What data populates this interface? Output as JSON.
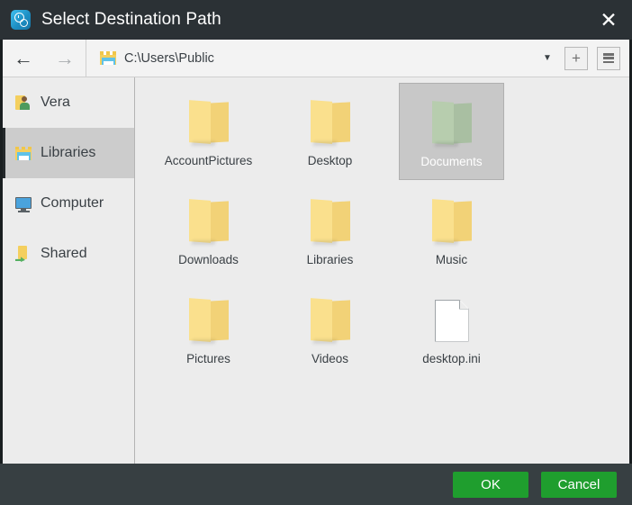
{
  "window": {
    "title": "Select Destination Path",
    "app_icon": "clock-gear-icon",
    "close_label": "✕",
    "titlebar_color": "#2b3135",
    "footer_color": "#373f42",
    "accent_color": "#1f9e2e"
  },
  "toolbar": {
    "back_label": "←",
    "forward_label": "→",
    "path_icon": "libraries-folder-icon",
    "path_value": "C:\\Users\\Public",
    "dropdown_label": "▼",
    "new_folder_label": "+",
    "view_toggle_icon": "list-view-icon"
  },
  "sidebar": {
    "items": [
      {
        "label": "Vera",
        "icon": "user-folder-icon",
        "selected": false
      },
      {
        "label": "Libraries",
        "icon": "libraries-icon",
        "selected": true
      },
      {
        "label": "Computer",
        "icon": "computer-icon",
        "selected": false
      },
      {
        "label": "Shared",
        "icon": "shared-folder-icon",
        "selected": false
      }
    ]
  },
  "files": {
    "items": [
      {
        "name": "AccountPictures",
        "type": "folder",
        "selected": false
      },
      {
        "name": "Desktop",
        "type": "folder",
        "selected": false
      },
      {
        "name": "Documents",
        "type": "folder",
        "selected": true
      },
      {
        "name": "Downloads",
        "type": "folder",
        "selected": false
      },
      {
        "name": "Libraries",
        "type": "folder",
        "selected": false
      },
      {
        "name": "Music",
        "type": "folder",
        "selected": false
      },
      {
        "name": "Pictures",
        "type": "folder",
        "selected": false
      },
      {
        "name": "Videos",
        "type": "folder",
        "selected": false
      },
      {
        "name": "desktop.ini",
        "type": "file",
        "selected": false
      }
    ]
  },
  "footer": {
    "ok_label": "OK",
    "cancel_label": "Cancel"
  }
}
